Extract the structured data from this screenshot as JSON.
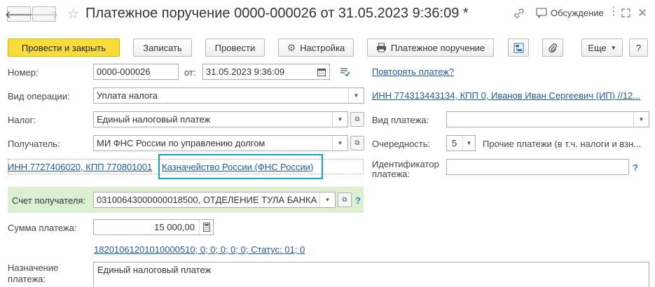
{
  "header": {
    "back_icon": "arrow-left-icon",
    "forward_icon": "arrow-right-icon",
    "favorite_icon": "star-icon",
    "title": "Платежное поручение 0000-000026 от 31.05.2023 9:36:09 *",
    "link_icon": "chain-link-icon",
    "discussion_label": "Обсуждение",
    "more_icon": "vertical-dots-icon",
    "maximize_icon": "expand-icon",
    "close_icon": "close-icon"
  },
  "toolbar": {
    "post_close_label": "Провести и закрыть",
    "save_label": "Записать",
    "post_label": "Провести",
    "settings_label": "Настройка",
    "print_label": "Платежное поручение",
    "more_label": "Еще",
    "help_label": "?"
  },
  "form": {
    "number_label": "Номер:",
    "number_value": "0000-000026",
    "date_label": "от:",
    "date_value": "31.05.2023  9:36:09",
    "repeat_link": "Повторять платеж?",
    "operation_label": "Вид операции:",
    "operation_value": "Уплата налога",
    "payer_link": "ИНН 774313443134, КПП 0, Иванов Иван Сергеевич (ИП) //12...",
    "tax_label": "Налог:",
    "tax_value": "Единый налоговый платеж",
    "payment_kind_label": "Вид платежа:",
    "payment_kind_value": "",
    "recipient_label": "Получатель:",
    "recipient_value": "МИ ФНС России по управлению долгом",
    "priority_label": "Очередность:",
    "priority_value": "5",
    "priority_desc": "Прочие платежи (в т.ч. налоги и взн...",
    "recipient_inn_link": "ИНН 7727406020, КПП 770801001",
    "treasury_link": "Казначейство России (ФНС России)",
    "identifier_label_1": "Идентификатор",
    "identifier_label_2": "платежа:",
    "identifier_value": "",
    "account_label": "Счет получателя:",
    "account_value": "03100643000000018500, ОТДЕЛЕНИЕ ТУЛА БАНКА",
    "amount_label": "Сумма платежа:",
    "amount_value": "15 000,00",
    "kbk_link": "18201061201010000510; 0; 0; 0; 0; 0; Статус: 01; 0",
    "purpose_label_1": "Назначение",
    "purpose_label_2": "платежа:",
    "purpose_value": "Единый налоговый платеж"
  },
  "colors": {
    "primary_button": "#f7dc3a",
    "link": "#1f5aa5",
    "highlight_border": "#1aa3b8",
    "account_band": "#dcefd1"
  }
}
